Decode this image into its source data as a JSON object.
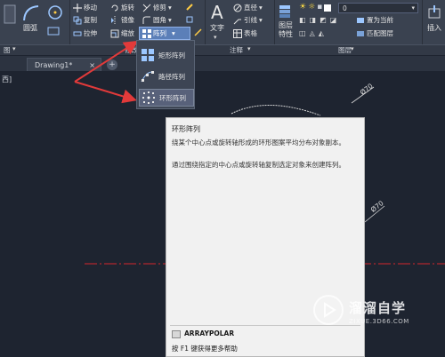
{
  "ribbon": {
    "panels": {
      "draw": "图",
      "modify": "修改",
      "annotation": "注释",
      "layers": "图层"
    },
    "draw_tools": {
      "circle": "圆弧"
    },
    "modify": {
      "move": "移动",
      "rotate": "旋转",
      "trim": "修剪",
      "copy": "复制",
      "mirror": "镜像",
      "fillet": "圆角",
      "stretch": "拉伸",
      "scale": "缩放",
      "array": "阵列"
    },
    "annotation": {
      "text": "文字",
      "dimension": "直径",
      "leader": "引线",
      "table": "表格"
    },
    "layers": {
      "layer_properties": "图层\n特性",
      "layer_combo_value": "0",
      "set_current": "置为当前",
      "match_layer": "匹配图层"
    },
    "insert": "插入"
  },
  "tabs": {
    "drawing": "Drawing1*"
  },
  "view_label": "西]",
  "dropdown": {
    "items": [
      {
        "label": "矩形阵列"
      },
      {
        "label": "路径阵列"
      },
      {
        "label": "环形阵列"
      }
    ]
  },
  "canvas": {
    "dim1": "Ø70",
    "dim2": "Ø70"
  },
  "tooltip": {
    "title": "环形阵列",
    "desc": "绕某个中心点或旋转轴形成的环形图案平均分布对象副本。",
    "desc2": "通过围绕指定的中心点或旋转轴复制选定对象来创建阵列。",
    "command": "ARRAYPOLAR",
    "help": "按 F1 键获得更多帮助"
  },
  "watermark": {
    "name": "溜溜自学",
    "url": "ZIXUE.3D66.COM"
  },
  "colors": {
    "accent_highlight": "#5b7fb8",
    "red_arrow": "#e23a3a",
    "centerline": "#d4262c"
  }
}
